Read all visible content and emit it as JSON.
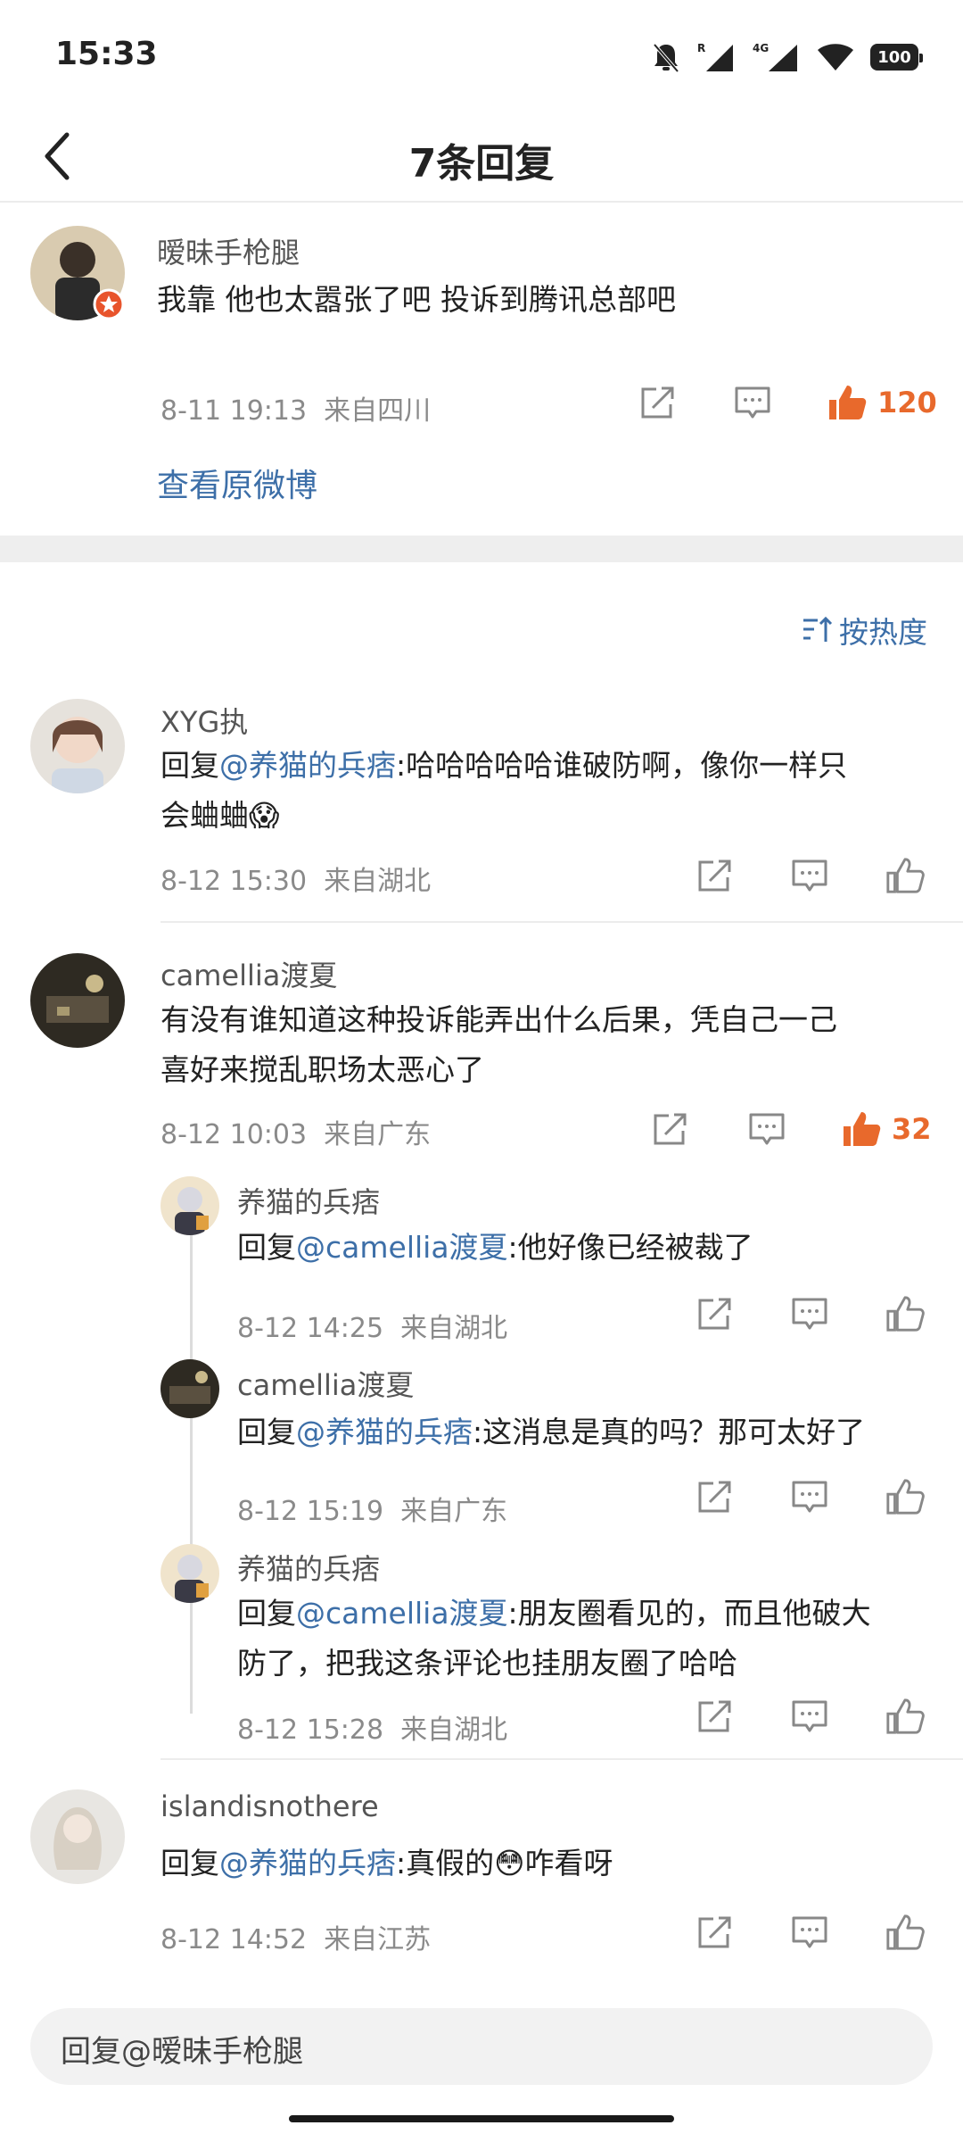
{
  "status": {
    "time": "15:33",
    "network": "4G",
    "battery": "100"
  },
  "header": {
    "title": "7条回复"
  },
  "root": {
    "username": "暧昧手枪腿",
    "text": "我靠 他也太嚣张了吧 投诉到腾讯总部吧",
    "time": "8-11 19:13",
    "location": "来自四川",
    "likes": "120",
    "view_original": "查看原微博"
  },
  "sort": {
    "label": "按热度"
  },
  "comments": [
    {
      "username": "XYG执",
      "prefix": "回复",
      "mention": "@养猫的兵痞",
      "text1": ":哈哈哈哈哈谁破防啊，像你一样只",
      "text2": "会蛐蛐",
      "emoji": "😱",
      "time": "8-12 15:30",
      "location": "来自湖北"
    },
    {
      "username": "camellia渡夏",
      "text1": "有没有谁知道这种投诉能弄出什么后果，凭自己一己",
      "text2": "喜好来搅乱职场太恶心了",
      "time": "8-12 10:03",
      "location": "来自广东",
      "likes": "32"
    }
  ],
  "subreplies": [
    {
      "username": "养猫的兵痞",
      "prefix": "回复",
      "mention": "@camellia渡夏",
      "text1": ":他好像已经被裁了",
      "time": "8-12 14:25",
      "location": "来自湖北"
    },
    {
      "username": "camellia渡夏",
      "prefix": "回复",
      "mention": "@养猫的兵痞",
      "text1": ":这消息是真的吗？那可太好了",
      "time": "8-12 15:19",
      "location": "来自广东"
    },
    {
      "username": "养猫的兵痞",
      "prefix": "回复",
      "mention": "@camellia渡夏",
      "text1": ":朋友圈看见的，而且他破大",
      "text2": "防了，把我这条评论也挂朋友圈了哈哈",
      "time": "8-12 15:28",
      "location": "来自湖北"
    }
  ],
  "last_comment": {
    "username": "islandisnothere",
    "prefix": "回复",
    "mention": "@养猫的兵痞",
    "text1": ":真假的",
    "emoji": "😳",
    "text1b": "咋看呀",
    "time": "8-12 14:52",
    "location": "来自江苏"
  },
  "reply_bar": {
    "placeholder": "回复@暧昧手枪腿"
  }
}
